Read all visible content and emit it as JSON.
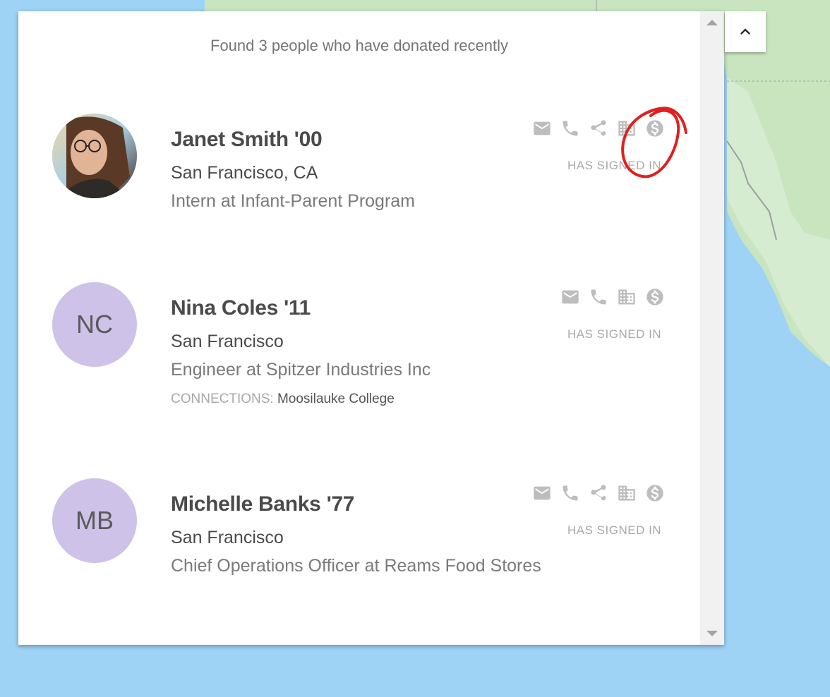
{
  "panel": {
    "summary": "Found 3 people who have donated recently"
  },
  "people": [
    {
      "name": "Janet Smith '00",
      "location": "San Francisco, CA",
      "job": "Intern at Infant-Parent Program",
      "status": "HAS SIGNED IN",
      "avatar_type": "photo",
      "icons": [
        "email-icon",
        "phone-icon",
        "share-icon",
        "building-icon",
        "dollar-icon"
      ]
    },
    {
      "name": "Nina Coles '11",
      "initials": "NC",
      "location": "San Francisco",
      "job": "Engineer at Spitzer Industries Inc",
      "connections_label": "CONNECTIONS:",
      "connections_value": "Moosilauke College",
      "status": "HAS SIGNED IN",
      "icons": [
        "email-icon",
        "phone-icon",
        "building-icon",
        "dollar-icon"
      ]
    },
    {
      "name": "Michelle Banks '77",
      "initials": "MB",
      "location": "San Francisco",
      "job": "Chief Operations Officer at Reams Food Stores",
      "status": "HAS SIGNED IN",
      "icons": [
        "email-icon",
        "phone-icon",
        "share-icon",
        "building-icon",
        "dollar-icon"
      ]
    }
  ],
  "colors": {
    "avatar_bg": "#cfc2e8",
    "icon": "#bdbdbd",
    "annotation": "#e02020",
    "water": "#9fd3f6",
    "land": "#c9e6c4"
  }
}
